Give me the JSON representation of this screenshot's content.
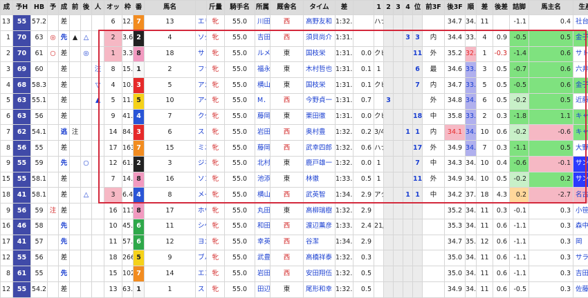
{
  "colors": {
    "frame1": "#f7f7f7",
    "frame2": "#222222",
    "frame3": "#e62a2a",
    "frame4": "#2a55d6",
    "frame5": "#f5d21a",
    "frame6": "#2fa84a",
    "frame7": "#f28c20",
    "frame8": "#f29ac0",
    "highlight": "#d3273a",
    "green": "#7fe27f",
    "navy": "#404aa8",
    "lav": "#b0b0ee",
    "pink": "#f6b8c4",
    "navyBright": "#2b3aff"
  },
  "headers": [
    "成",
    "予H",
    "HB",
    "予",
    "成",
    "前",
    "後",
    "人",
    "オッ",
    "枠",
    "番",
    "馬名",
    "",
    "斤量",
    "騎手名",
    "所属",
    "厩舎名",
    "タイム",
    "差",
    "",
    "1",
    "2",
    "3",
    "4",
    "位",
    "前3F",
    "後3F",
    "順",
    "差",
    "後差",
    "詰脚",
    "馬主名",
    "生産者名"
  ],
  "rows": [
    {
      "no": "13",
      "h": "55",
      "ph": "57.2",
      "hb": "",
      "yo": "差",
      "sei": "",
      "mae": "",
      "ato": "",
      "nin": "6",
      "odds": "12.5",
      "waku": "7",
      "uma": "13",
      "name": "エリザベスタワー",
      "sex": "牝",
      "kin": "55.0",
      "jockey": "川田将雅",
      "shozoku": "西",
      "trainer": "高野友和",
      "time": "1:32.6",
      "sa": "",
      "note": "ハナ",
      "c1": "",
      "c2": "",
      "c3": "",
      "c4": "",
      "pos": "",
      "f3": "34.7",
      "l3": "34.7",
      "jun": "11",
      "sa2": "",
      "atosa": "-1.1",
      "tsume": "0.4",
      "owner": "社台レースホ",
      "breeder": "Shadai"
    },
    {
      "no": "1",
      "h": "70",
      "ph": "63",
      "hb": "◎",
      "yo": "先",
      "sei": "▲",
      "mae": "△",
      "ato": "",
      "nin": "2",
      "odds": "3.6",
      "waku": "2",
      "uma": "4",
      "name": "ソダシ",
      "sex": "牝",
      "kin": "55.0",
      "jockey": "吉田隼人",
      "shozoku": "西",
      "trainer": "須貝尚介",
      "time": "1:31.1",
      "sa": "",
      "note": "",
      "c1": "",
      "c2": "",
      "c3": "3",
      "c4": "3",
      "pos": "内",
      "f3": "34.4",
      "l3": "33.8",
      "jun": "4",
      "sa2": "0.9",
      "atosa": "-0.5",
      "tsume": "0.5",
      "owner": "金子真人ホー",
      "breeder": "ノーザンファ"
    },
    {
      "no": "2",
      "h": "70",
      "ph": "61",
      "hb": "○",
      "yo": "差",
      "sei": "",
      "mae": "◎",
      "ato": "",
      "nin": "1",
      "odds": "3.3",
      "waku": "8",
      "uma": "18",
      "name": "サトノレイナス",
      "sex": "牝",
      "kin": "55.0",
      "jockey": "ルメール",
      "shozoku": "東",
      "trainer": "国枝栄",
      "time": "1:31.1",
      "sa": "0.0",
      "note": "クビ",
      "c1": "",
      "c2": "",
      "c3": "",
      "c4": "11",
      "pos": "外",
      "f3": "35.2",
      "l3": "32.9",
      "jun": "1",
      "sa2": "-0.3",
      "atosa": "-1.4",
      "tsume": "0.6",
      "owner": "サトミホース",
      "breeder": "ノーザンファ"
    },
    {
      "no": "3",
      "h": "69",
      "ph": "60",
      "hb": "",
      "yo": "差",
      "sei": "",
      "mae": "",
      "ato": "注",
      "nin": "8",
      "odds": "15.3",
      "waku": "1",
      "uma": "2",
      "name": "ファインルージュ",
      "sex": "牝",
      "kin": "55.0",
      "jockey": "福永祐一",
      "shozoku": "東",
      "trainer": "木村哲也",
      "time": "1:31.2",
      "sa": "0.1",
      "note": "1",
      "c1": "",
      "c2": "",
      "c3": "",
      "c4": "6",
      "pos": "最",
      "f3": "34.6",
      "l3": "33.7",
      "jun": "3",
      "sa2": "0.5",
      "atosa": "-0.7",
      "tsume": "0.6",
      "owner": "六井　元一",
      "breeder": "ノーザンファ"
    },
    {
      "no": "4",
      "h": "68",
      "ph": "58.3",
      "hb": "",
      "yo": "差",
      "sei": "",
      "mae": "",
      "ato": "▽",
      "nin": "4",
      "odds": "10.5",
      "waku": "3",
      "uma": "5",
      "name": "アカイトリノムスメ",
      "sex": "牝",
      "kin": "55.0",
      "jockey": "横山武史",
      "shozoku": "東",
      "trainer": "国枝栄",
      "time": "1:31.2",
      "sa": "0.1",
      "note": "クビ",
      "c1": "",
      "c2": "",
      "c3": "",
      "c4": "7",
      "pos": "内",
      "f3": "34.7",
      "l3": "33.9",
      "jun": "5",
      "sa2": "0.5",
      "atosa": "-0.5",
      "tsume": "0.6",
      "owner": "金子真人ホー",
      "breeder": "ノーザンファ"
    },
    {
      "no": "5",
      "h": "63",
      "ph": "55.1",
      "hb": "",
      "yo": "差",
      "sei": "",
      "mae": "",
      "ato": "▲",
      "nin": "5",
      "odds": "11.8",
      "waku": "5",
      "uma": "10",
      "name": "アールドヴィーヴル",
      "sex": "牝",
      "kin": "55.0",
      "jockey": "M．デム",
      "shozoku": "西",
      "trainer": "今野貞一",
      "time": "1:31.8",
      "sa": "0.7",
      "note": "",
      "c1": "3",
      "c2": "",
      "c3": "",
      "c4": "",
      "pos": "外",
      "f3": "34.8",
      "l3": "34.0",
      "jun": "6",
      "sa2": "0.5",
      "atosa": "-0.2",
      "tsume": "0.5",
      "owner": "近藤　英子",
      "breeder": "ノーザンファ"
    },
    {
      "no": "6",
      "h": "63",
      "ph": "56",
      "hb": "",
      "yo": "差",
      "sei": "",
      "mae": "",
      "ato": "",
      "nin": "9",
      "odds": "41.9",
      "waku": "4",
      "uma": "7",
      "name": "ククナ",
      "sex": "牝",
      "kin": "55.0",
      "jockey": "藤岡佑介",
      "shozoku": "東",
      "trainer": "栗田徹",
      "time": "1:31.8",
      "sa": "0.0",
      "note": "クビ",
      "c1": "",
      "c2": "",
      "c3": "",
      "c4": "18",
      "pos": "中",
      "f3": "35.8",
      "l3": "33.2",
      "jun": "2",
      "sa2": "0.3",
      "atosa": "-1.8",
      "tsume": "1.1",
      "owner": "キャロットフ",
      "breeder": "ノーザンファ"
    },
    {
      "no": "7",
      "h": "62",
      "ph": "54.1",
      "hb": "",
      "yo": "逃",
      "sei": "注",
      "mae": "",
      "ato": "",
      "nin": "14",
      "odds": "84.8",
      "waku": "3",
      "uma": "6",
      "name": "ストゥーティ",
      "sex": "牝",
      "kin": "55.0",
      "jockey": "岩田康誠",
      "shozoku": "西",
      "trainer": "奥村豊",
      "time": "1:32.0",
      "sa": "0.2",
      "note": "3/4",
      "c1": "",
      "c2": "",
      "c3": "1",
      "c4": "1",
      "pos": "内",
      "f3": "34.1",
      "l3": "34.6",
      "jun": "10",
      "sa2": "0.6",
      "atosa": "-0.2",
      "tsume": "-0.6",
      "owner": "キャロットフ",
      "breeder": "ノーザンファ"
    },
    {
      "no": "8",
      "h": "56",
      "ph": "55",
      "hb": "",
      "yo": "差",
      "sei": "",
      "mae": "",
      "ato": "",
      "nin": "17",
      "odds": "163.0",
      "waku": "7",
      "uma": "15",
      "name": "ミニーアイル",
      "sex": "牝",
      "kin": "55.0",
      "jockey": "藤岡康太",
      "shozoku": "西",
      "trainer": "武幸四郎",
      "time": "1:32.6",
      "sa": "0.6",
      "note": "ハナ",
      "c1": "",
      "c2": "",
      "c3": "",
      "c4": "17",
      "pos": "外",
      "f3": "34.9",
      "l3": "34.1",
      "jun": "7",
      "sa2": "0.3",
      "atosa": "-1.1",
      "tsume": "0.5",
      "owner": "大野　剛嗣",
      "breeder": "ノーザンファ"
    },
    {
      "no": "9",
      "h": "55",
      "ph": "59",
      "hb": "",
      "yo": "先",
      "sei": "",
      "mae": "○",
      "ato": "",
      "nin": "12",
      "odds": "61.3",
      "waku": "2",
      "uma": "3",
      "name": "ジネストラ",
      "sex": "牝",
      "kin": "55.0",
      "jockey": "北村宏司",
      "shozoku": "東",
      "trainer": "鹿戸雄一",
      "time": "1:32.6",
      "sa": "0.0",
      "note": "1",
      "c1": "",
      "c2": "",
      "c3": "",
      "c4": "7",
      "pos": "中",
      "f3": "34.3",
      "l3": "34.4",
      "jun": "10",
      "sa2": "0.4",
      "atosa": "-0.6",
      "tsume": "-0.1",
      "owner": "サンデーレー",
      "breeder": "ノーザンファ"
    },
    {
      "no": "15",
      "h": "55",
      "ph": "58.1",
      "hb": "",
      "yo": "差",
      "sei": "",
      "mae": "",
      "ato": "",
      "nin": "7",
      "odds": "14.7",
      "waku": "8",
      "uma": "16",
      "name": "ソングラティ",
      "sex": "牝",
      "kin": "55.0",
      "jockey": "池添謙一",
      "shozoku": "東",
      "trainer": "林徹",
      "time": "1:33.1",
      "sa": "0.5",
      "note": "1",
      "c1": "",
      "c2": "",
      "c3": "",
      "c4": "11",
      "pos": "外",
      "f3": "34.9",
      "l3": "34.8",
      "jun": "10",
      "sa2": "0.5",
      "atosa": "-0.2",
      "tsume": "0.2",
      "owner": "サンデーレー",
      "breeder": "ノーザンファ"
    },
    {
      "no": "18",
      "h": "41",
      "ph": "58.1",
      "hb": "",
      "yo": "差",
      "sei": "",
      "mae": "△",
      "ato": "",
      "nin": "3",
      "odds": "6.4",
      "waku": "4",
      "uma": "8",
      "name": "メイケイエール",
      "sex": "牝",
      "kin": "55.0",
      "jockey": "横山典弘",
      "shozoku": "西",
      "trainer": "武英智",
      "time": "1:34.0",
      "sa": "2.9",
      "note": "アタマ",
      "c1": "",
      "c2": "",
      "c3": "1",
      "c4": "1",
      "pos": "中",
      "f3": "34.2",
      "l3": "37.2",
      "jun": "18",
      "sa2": "4.3",
      "atosa": "0.2",
      "tsume": "-2.7",
      "owner": "名古屋競馬",
      "breeder": "ノーザンファ"
    },
    {
      "no": "9",
      "h": "56",
      "ph": "59",
      "hb": "注",
      "yo": "差",
      "sei": "",
      "mae": "",
      "ato": "",
      "nin": "16",
      "odds": "111.4",
      "waku": "8",
      "uma": "17",
      "name": "ホウオウイクセル",
      "sex": "牝",
      "kin": "55.0",
      "jockey": "丸田恭介",
      "shozoku": "東",
      "trainer": "高柳瑞樹",
      "time": "1:32.7",
      "sa": "2.9",
      "note": "",
      "c1": "",
      "c2": "",
      "c3": "",
      "c4": "",
      "pos": "",
      "f3": "35.2",
      "l3": "34.7",
      "jun": "11",
      "sa2": "0.3",
      "atosa": "-0.1",
      "tsume": "0.3",
      "owner": "小笹　芳央",
      "breeder": "レイクヴィラ"
    },
    {
      "no": "16",
      "h": "46",
      "ph": "58",
      "hb": "",
      "yo": "先",
      "sei": "",
      "mae": "",
      "ato": "",
      "nin": "10",
      "odds": "45.8",
      "waku": "6",
      "uma": "11",
      "name": "シゲルピンクルビー",
      "sex": "牝",
      "kin": "55.0",
      "jockey": "和田竜二",
      "shozoku": "西",
      "trainer": "渡辺薫彦",
      "time": "1:33.5",
      "sa": "2.4",
      "note": "21/2",
      "c1": "",
      "c2": "",
      "c3": "",
      "c4": "",
      "pos": "",
      "f3": "35.3",
      "l3": "34.7",
      "jun": "11",
      "sa2": "0.6",
      "atosa": "-1.1",
      "tsume": "0.3",
      "owner": "森中　蕃",
      "breeder": "天羽牧場"
    },
    {
      "no": "17",
      "h": "41",
      "ph": "57",
      "hb": "",
      "yo": "先",
      "sei": "",
      "mae": "",
      "ato": "",
      "nin": "11",
      "odds": "57.2",
      "waku": "6",
      "uma": "12",
      "name": "ヨカヨカ",
      "sex": "牝",
      "kin": "55.0",
      "jockey": "幸英明",
      "shozoku": "西",
      "trainer": "谷潔",
      "time": "1:34.0",
      "sa": "2.9",
      "note": "",
      "c1": "",
      "c2": "",
      "c3": "",
      "c4": "",
      "pos": "",
      "f3": "34.7",
      "l3": "35.2",
      "jun": "12",
      "sa2": "0.6",
      "atosa": "-1.1",
      "tsume": "0.3",
      "owner": "岡　浩二",
      "breeder": "本田　土寿"
    },
    {
      "no": "12",
      "h": "55",
      "ph": "56",
      "hb": "",
      "yo": "差",
      "sei": "",
      "mae": "",
      "ato": "",
      "nin": "18",
      "odds": "266.6",
      "waku": "5",
      "uma": "9",
      "name": "ブルーバード",
      "sex": "牝",
      "kin": "55.0",
      "jockey": "武豊",
      "shozoku": "西",
      "trainer": "高橋祥泰",
      "time": "1:32.8",
      "sa": "0.3",
      "note": "",
      "c1": "",
      "c2": "",
      "c3": "",
      "c4": "",
      "pos": "",
      "f3": "35.0",
      "l3": "34.9",
      "jun": "11",
      "sa2": "0.6",
      "atosa": "-1.1",
      "tsume": "0.3",
      "owner": "サラブレッド",
      "breeder": "水丸牧場"
    },
    {
      "no": "8",
      "h": "61",
      "ph": "55",
      "hb": "",
      "yo": "先",
      "sei": "",
      "mae": "",
      "ato": "",
      "nin": "15",
      "odds": "102.3",
      "waku": "7",
      "uma": "14",
      "name": "エンスージアズム",
      "sex": "牝",
      "kin": "55.0",
      "jockey": "岩田望来",
      "shozoku": "西",
      "trainer": "安田翔伍",
      "time": "1:32.6",
      "sa": "0.5",
      "note": "",
      "c1": "",
      "c2": "",
      "c3": "",
      "c4": "",
      "pos": "",
      "f3": "35.0",
      "l3": "34.6",
      "jun": "11",
      "sa2": "0.6",
      "atosa": "-1.1",
      "tsume": "0.3",
      "owner": "吉田　照哉",
      "breeder": "社台ファーム"
    },
    {
      "no": "12",
      "h": "55",
      "ph": "54.2",
      "hb": "",
      "yo": "差",
      "sei": "",
      "mae": "",
      "ato": "",
      "nin": "13",
      "odds": "63.6",
      "waku": "1",
      "uma": "1",
      "name": "ストライプ",
      "sex": "牝",
      "kin": "55.0",
      "jockey": "田辺裕信",
      "shozoku": "東",
      "trainer": "尾形和幸",
      "time": "1:32.6",
      "sa": "0.5",
      "note": "",
      "c1": "",
      "c2": "",
      "c3": "",
      "c4": "",
      "pos": "",
      "f3": "34.9",
      "l3": "34.6",
      "jun": "11",
      "sa2": "0.6",
      "atosa": "-0.5",
      "tsume": "0.3",
      "owner": "佐藤　壽男",
      "breeder": "荒木　重治"
    }
  ]
}
